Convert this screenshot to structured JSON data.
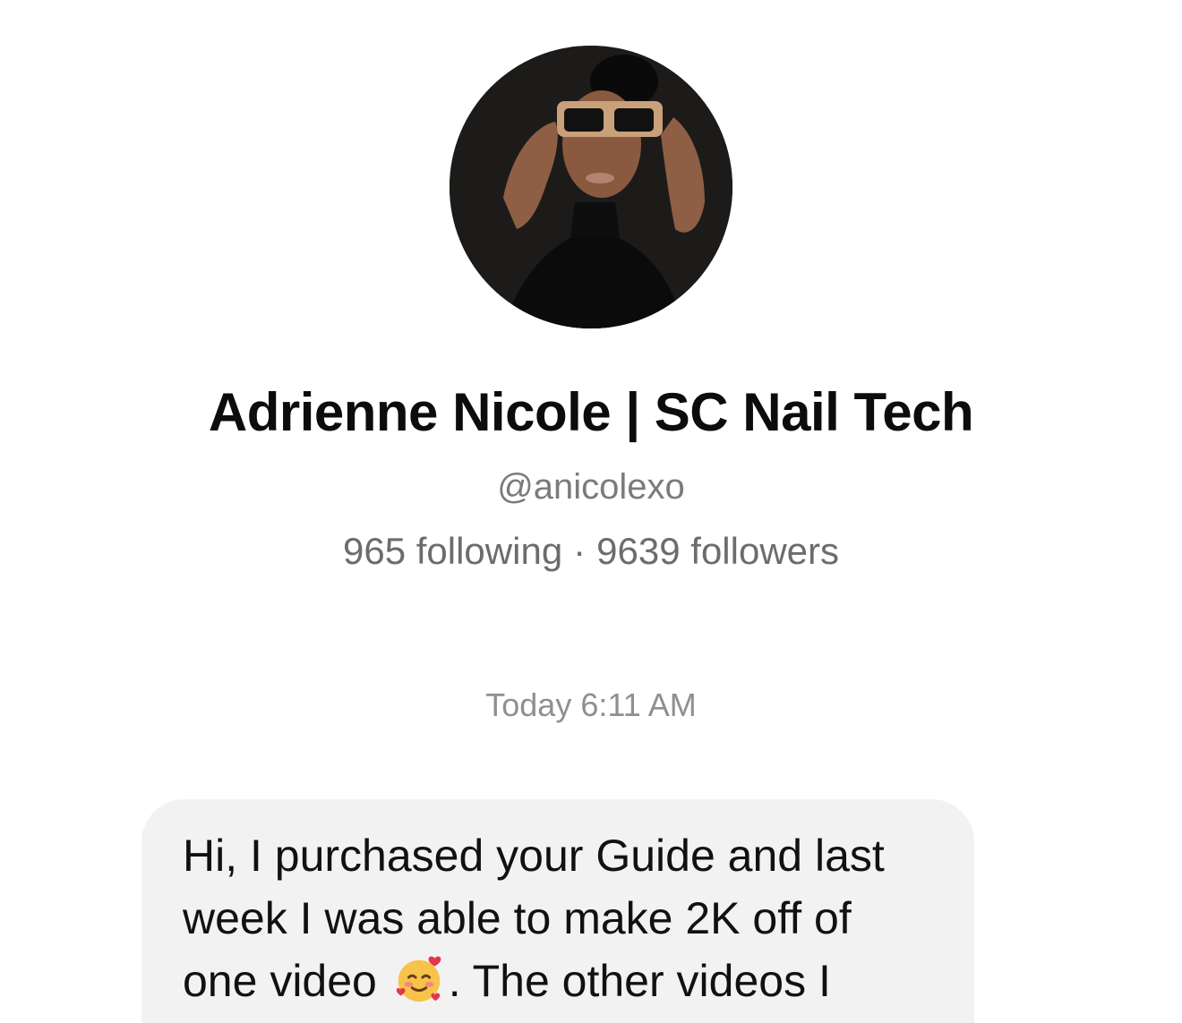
{
  "profile": {
    "display_name": "Adrienne Nicole | SC Nail Tech",
    "handle": "@anicolexo",
    "following": "965 following",
    "separator": "·",
    "followers": "9639 followers"
  },
  "conversation": {
    "timestamp": "Today 6:11 AM",
    "messages": [
      {
        "line1": "Hi, I purchased your Guide and last",
        "line2": "week I was able to make 2K off of",
        "line3_before": "one video ",
        "emoji": "smiling-face-with-hearts-icon",
        "line3_after": ". The other videos I"
      }
    ]
  },
  "colors": {
    "background": "#ffffff",
    "bubble": "#f2f2f2",
    "secondary_text": "#7b7b7b"
  }
}
